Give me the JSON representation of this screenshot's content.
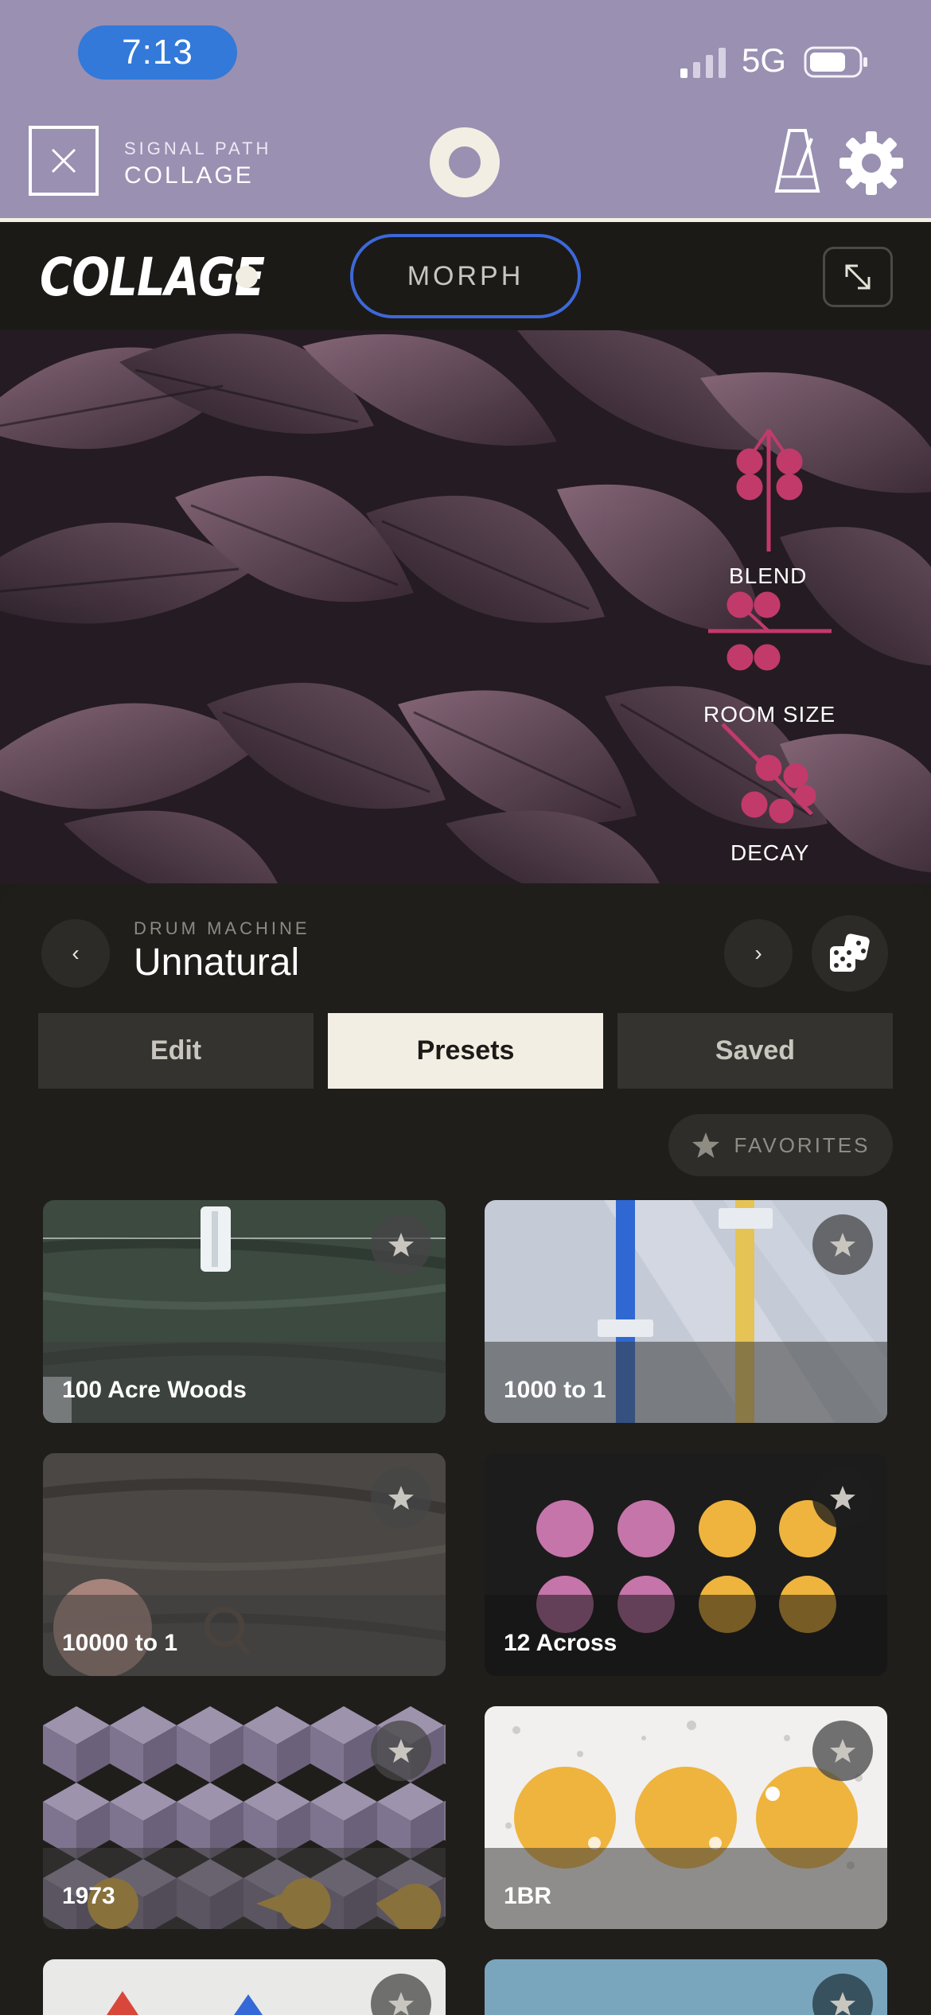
{
  "status_bar": {
    "time": "7:13",
    "network": "5G"
  },
  "app_header": {
    "section_label": "SIGNAL PATH",
    "plugin_name": "COLLAGE",
    "accent": "#9a90b2"
  },
  "plugin": {
    "logo": "COLLAGE",
    "morph_label": "MORPH",
    "knobs": [
      "BLEND",
      "ROOM SIZE",
      "DECAY"
    ],
    "knob_color": "#c23a6a"
  },
  "preset_nav": {
    "category": "DRUM MACHINE",
    "current": "Unnatural",
    "prev_icon": "‹",
    "next_icon": "›"
  },
  "tabs": [
    {
      "label": "Edit",
      "active": false
    },
    {
      "label": "Presets",
      "active": true
    },
    {
      "label": "Saved",
      "active": false
    }
  ],
  "favorites_label": "FAVORITES",
  "presets": [
    {
      "name": "100 Acre Woods"
    },
    {
      "name": "1000 to 1"
    },
    {
      "name": "10000 to 1"
    },
    {
      "name": "12 Across"
    },
    {
      "name": "1973"
    },
    {
      "name": "1BR"
    }
  ]
}
